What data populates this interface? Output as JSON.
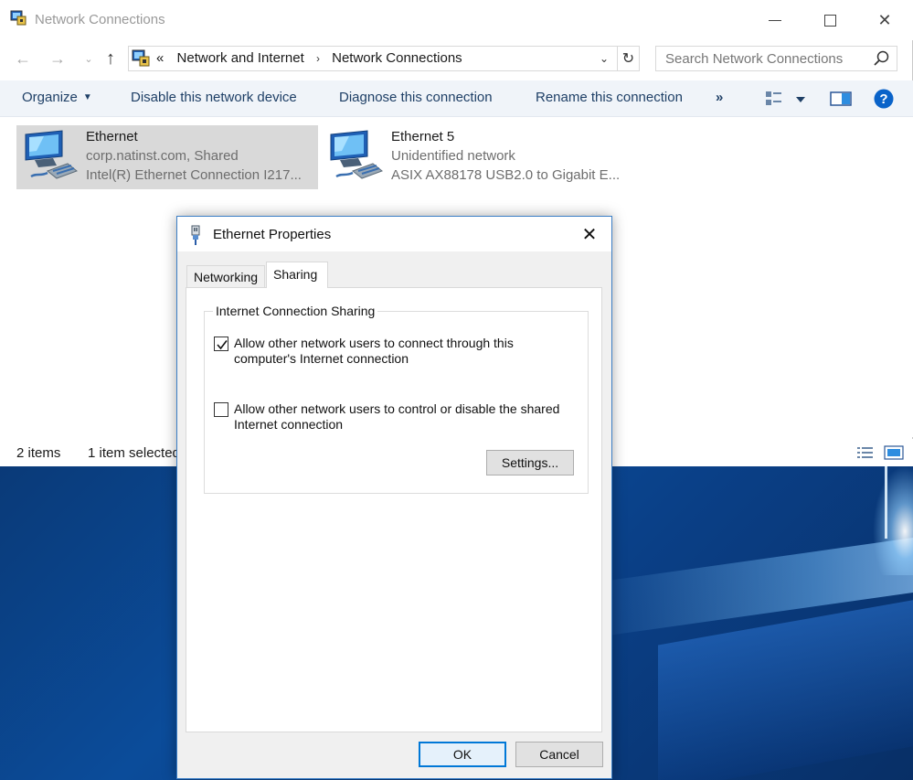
{
  "window": {
    "title": "Network Connections",
    "minimize": "",
    "maximize": "",
    "close": "✕"
  },
  "nav": {
    "back": "←",
    "forward": "→",
    "recent": "⌄",
    "up": "↑",
    "overflow": "«",
    "breadcrumbs": [
      "Network and Internet",
      "Network Connections"
    ],
    "separator": "›",
    "dropdown": "⌄",
    "refresh": "↻"
  },
  "search": {
    "placeholder": "Search Network Connections",
    "value": ""
  },
  "toolbar": {
    "organize": "Organize",
    "disable": "Disable this network device",
    "diagnose": "Diagnose this connection",
    "rename": "Rename this connection",
    "more": "»"
  },
  "items": [
    {
      "name": "Ethernet",
      "status": "corp.natinst.com, Shared",
      "device": "Intel(R) Ethernet Connection I217...",
      "selected": true
    },
    {
      "name": "Ethernet 5",
      "status": "Unidentified network",
      "device": "ASIX AX88178 USB2.0 to Gigabit E...",
      "selected": false
    }
  ],
  "status": {
    "count": "2 items",
    "selection": "1 item selected"
  },
  "dialog": {
    "title": "Ethernet Properties",
    "close": "✕",
    "tabs": [
      "Networking",
      "Sharing"
    ],
    "active_tab": "Sharing",
    "group_label": "Internet Connection Sharing",
    "option1": {
      "label": "Allow other network users to connect through this computer's Internet connection",
      "checked": true
    },
    "option2": {
      "label": "Allow other network users to control or disable the shared Internet connection",
      "checked": false
    },
    "settings_button": "Settings...",
    "ok_button": "OK",
    "cancel_button": "Cancel"
  },
  "colors": {
    "toolbar_bg": "#f0f4f9",
    "toolbar_text": "#1e3f66",
    "selection_bg": "#d9d9d9",
    "dialog_border": "#3c7fc6",
    "default_button_border": "#0078d7",
    "help_blue": "#0a63c9",
    "desktop_blue": "#0b4c9a"
  },
  "icons": {
    "app": "network-connections-icon",
    "nic": "network-adapter-icon",
    "search": "magnifier-icon",
    "help": "help-icon",
    "change_view": "change-view-icon",
    "preview_pane": "preview-pane-icon",
    "details_view": "details-view-icon",
    "large_icons_view": "large-icons-view-icon",
    "dialog": "ethernet-plug-icon"
  }
}
